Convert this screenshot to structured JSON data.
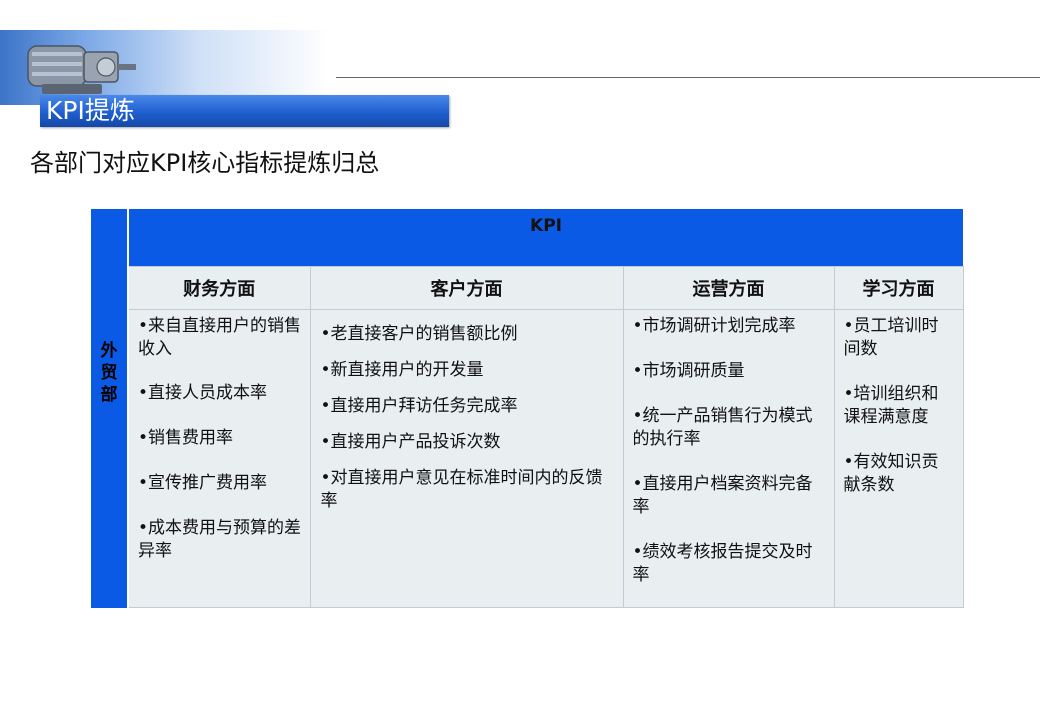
{
  "header": {
    "title": "KPI提炼",
    "subtitle": "各部门对应KPI核心指标提炼归总"
  },
  "table": {
    "kpi_header": "KPI",
    "dept": [
      "外",
      "贸",
      "部"
    ],
    "categories": [
      {
        "label": "财务方面",
        "items": [
          "•来自直接用户的销售收入",
          "•直接人员成本率",
          "•销售费用率",
          "•宣传推广费用率",
          "•成本费用与预算的差异率"
        ]
      },
      {
        "label": "客户方面",
        "items": [
          "•老直接客户的销售额比例",
          "•新直接用户的开发量",
          "•直接用户拜访任务完成率",
          "•直接用户产品投诉次数",
          "•对直接用户意见在标准时间内的反馈率"
        ]
      },
      {
        "label": "运营方面",
        "items": [
          "•市场调研计划完成率",
          "•市场调研质量",
          "•统一产品销售行为模式的执行率",
          "•直接用户档案资料完备率",
          "•绩效考核报告提交及时率"
        ]
      },
      {
        "label": "学习方面",
        "items": [
          "•员工培训时间数",
          "•培训组织和课程满意度",
          "•有效知识贡献条数"
        ]
      }
    ]
  },
  "colors": {
    "table_header_blue": "#0a5ae6",
    "cell_background": "#e9eef1",
    "title_bar": "#1f5fd0"
  }
}
